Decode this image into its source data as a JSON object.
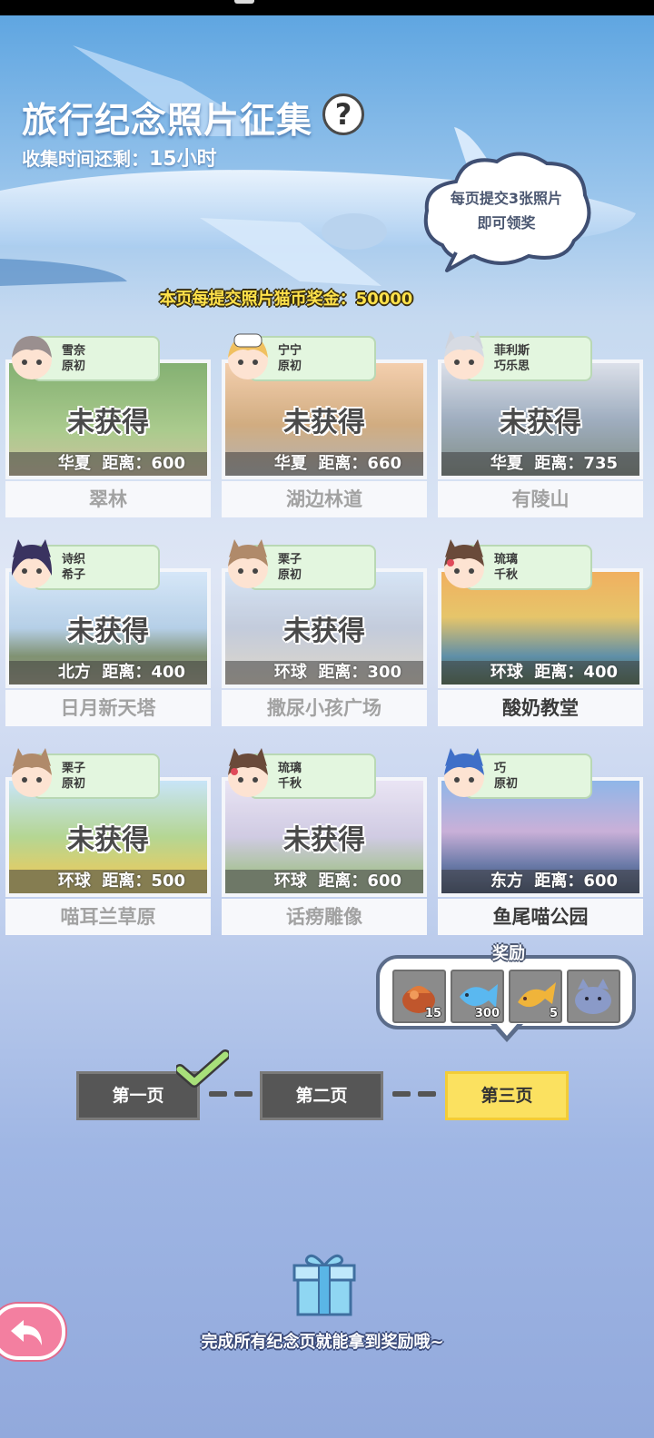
{
  "header": {
    "title": "旅行纪念照片征集",
    "timer_label": "收集时间还剩：",
    "timer_value": "15小时",
    "cloud_line1": "每页提交3张照片",
    "cloud_line2": "即可领奖",
    "bonus": "本页每提交照片猫币奖金：50000"
  },
  "locked_label": "未获得",
  "cards": [
    {
      "char1": "雪奈",
      "char2": "原初",
      "region": "华夏",
      "dist_label": "距离：",
      "dist": "600",
      "name": "翠林",
      "locked": true
    },
    {
      "char1": "宁宁",
      "char2": "原初",
      "region": "华夏",
      "dist_label": "距离：",
      "dist": "660",
      "name": "湖边林道",
      "locked": true
    },
    {
      "char1": "菲利斯",
      "char2": "巧乐思",
      "region": "华夏",
      "dist_label": "距离：",
      "dist": "735",
      "name": "有陵山",
      "locked": true
    },
    {
      "char1": "诗织",
      "char2": "希子",
      "region": "北方",
      "dist_label": "距离：",
      "dist": "400",
      "name": "日月新天塔",
      "locked": true
    },
    {
      "char1": "栗子",
      "char2": "原初",
      "region": "环球",
      "dist_label": "距离：",
      "dist": "300",
      "name": "撒尿小孩广场",
      "locked": true
    },
    {
      "char1": "琉璃",
      "char2": "千秋",
      "region": "环球",
      "dist_label": "距离：",
      "dist": "400",
      "name": "酸奶教堂",
      "locked": false
    },
    {
      "char1": "栗子",
      "char2": "原初",
      "region": "环球",
      "dist_label": "距离：",
      "dist": "500",
      "name": "喵耳兰草原",
      "locked": true
    },
    {
      "char1": "琉璃",
      "char2": "千秋",
      "region": "环球",
      "dist_label": "距离：",
      "dist": "600",
      "name": "话痨雕像",
      "locked": true
    },
    {
      "char1": "巧",
      "char2": "原初",
      "region": "东方",
      "dist_label": "距离：",
      "dist": "600",
      "name": "鱼尾喵公园",
      "locked": false
    }
  ],
  "reward": {
    "title": "奖励",
    "items": [
      {
        "icon": "fish-basket-icon",
        "count": "15"
      },
      {
        "icon": "blue-fish-icon",
        "count": "300"
      },
      {
        "icon": "gold-fish-icon",
        "count": "5"
      },
      {
        "icon": "cat-plush-icon",
        "count": ""
      }
    ]
  },
  "pages": [
    "第一页",
    "第二页",
    "第三页"
  ],
  "active_page": 3,
  "bottom_text": "完成所有纪念页就能拿到奖励哦~",
  "colors": {
    "accent": "#fbe160",
    "bonus": "#ffe24a",
    "tag": "#e3f6df",
    "back": "#f37fa0"
  }
}
